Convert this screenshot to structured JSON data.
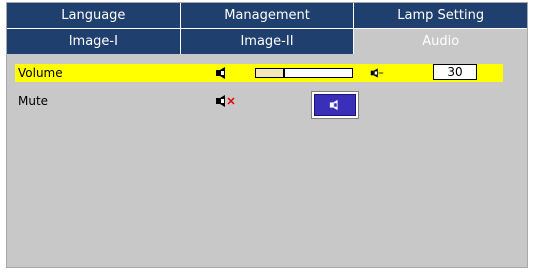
{
  "tabs_top": [
    "Language",
    "Management",
    "Lamp Setting"
  ],
  "tabs_second": [
    "Image-I",
    "Image-II",
    "Audio"
  ],
  "active_tab": "Audio",
  "volume": {
    "label": "Volume",
    "value": "30",
    "level": 0.3
  },
  "mute": {
    "label": "Mute"
  },
  "colors": {
    "tab_bg": "#1f3f6e",
    "panel_bg": "#c8c8c8",
    "highlight": "#ffff00",
    "mute_button": "#3a2fb8"
  },
  "icons": {
    "speaker": "speaker-icon",
    "speaker_muted": "speaker-muted-icon"
  }
}
